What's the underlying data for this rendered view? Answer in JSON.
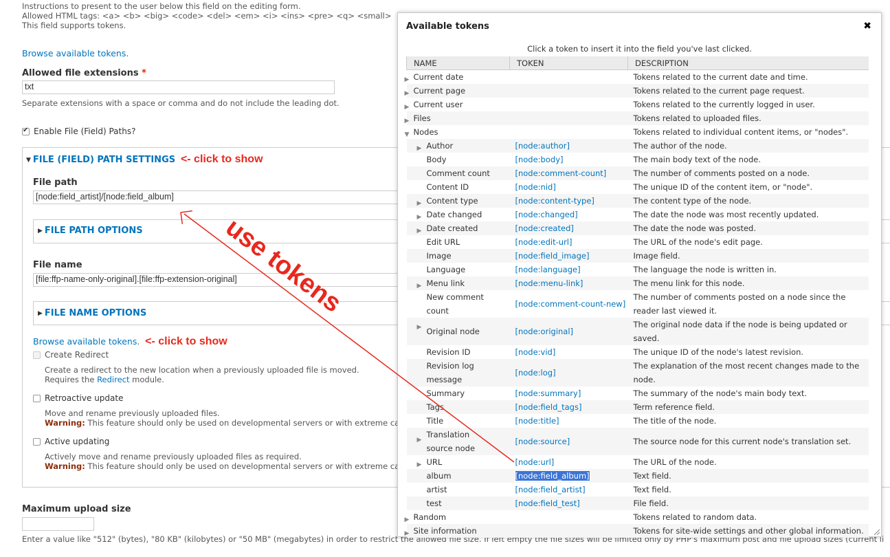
{
  "top": {
    "line1": "Instructions to present to the user below this field on the editing form.",
    "line2": "Allowed HTML tags: <a> <b> <big> <code> <del> <em> <i> <ins> <pre> <q> <small>",
    "line3": "This field supports tokens."
  },
  "browse_tokens_link": "Browse available tokens.",
  "allowed_ext": {
    "label": "Allowed file extensions",
    "required": "*",
    "value": "txt",
    "desc": "Separate extensions with a space or comma and do not include the leading dot."
  },
  "enable_ffp": {
    "label": "Enable File (Field) Paths?",
    "checked": true
  },
  "ffp_settings": {
    "legend": "FILE (FIELD) PATH SETTINGS",
    "note": "<- click to show",
    "file_path_label": "File path",
    "file_path_value": "[node:field_artist]/[node:field_album]",
    "file_path_options": "FILE PATH OPTIONS",
    "file_name_label": "File name",
    "file_name_value": "[file:ffp-name-only-original].[file:ffp-extension-original]",
    "file_name_options": "FILE NAME OPTIONS",
    "browse_link": "Browse available tokens.",
    "browse_note": "<- click to show",
    "create_redirect": {
      "label": "Create Redirect",
      "desc1": "Create a redirect to the new location when a previously uploaded file is moved.",
      "desc2_pre": "Requires the ",
      "desc2_link": "Redirect",
      "desc2_post": " module."
    },
    "retroactive": {
      "label": "Retroactive update",
      "desc1": "Move and rename previously uploaded files.",
      "warn": "Warning:",
      "desc2": " This feature should only be used on developmental servers or with extreme ca"
    },
    "active": {
      "label": "Active updating",
      "desc1": "Actively move and rename previously uploaded files as required.",
      "warn": "Warning:",
      "desc2": " This feature should only be used on developmental servers or with extreme ca"
    }
  },
  "max_upload": {
    "label": "Maximum upload size",
    "value": "",
    "desc": "Enter a value like \"512\" (bytes), \"80 KB\" (kilobytes) or \"50 MB\" (megabytes) in order to restrict the allowed file size. If left empty the file sizes will be limited only by PHP's maximum post and file upload sizes (current li"
  },
  "annotation": {
    "text": "use tokens",
    "color": "#e8281e"
  },
  "dialog": {
    "title": "Available tokens",
    "close": "✖",
    "instructions": "Click a token to insert it into the field you've last clicked.",
    "headers": [
      "NAME",
      "TOKEN",
      "DESCRIPTION"
    ],
    "rows": [
      {
        "name": "Current date",
        "token": "",
        "desc": "Tokens related to the current date and time.",
        "level": 0,
        "expander": "right"
      },
      {
        "name": "Current page",
        "token": "",
        "desc": "Tokens related to the current page request.",
        "level": 0,
        "expander": "right"
      },
      {
        "name": "Current user",
        "token": "",
        "desc": "Tokens related to the currently logged in user.",
        "level": 0,
        "expander": "right"
      },
      {
        "name": "Files",
        "token": "",
        "desc": "Tokens related to uploaded files.",
        "level": 0,
        "expander": "right"
      },
      {
        "name": "Nodes",
        "token": "",
        "desc": "Tokens related to individual content items, or \"nodes\".",
        "level": 0,
        "expander": "down"
      },
      {
        "name": "Author",
        "token": "[node:author]",
        "desc": "The author of the node.",
        "level": 1,
        "expander": "right"
      },
      {
        "name": "Body",
        "token": "[node:body]",
        "desc": "The main body text of the node.",
        "level": 1,
        "expander": ""
      },
      {
        "name": "Comment count",
        "token": "[node:comment-count]",
        "desc": "The number of comments posted on a node.",
        "level": 1,
        "expander": ""
      },
      {
        "name": "Content ID",
        "token": "[node:nid]",
        "desc": "The unique ID of the content item, or \"node\".",
        "level": 1,
        "expander": ""
      },
      {
        "name": "Content type",
        "token": "[node:content-type]",
        "desc": "The content type of the node.",
        "level": 1,
        "expander": "right"
      },
      {
        "name": "Date changed",
        "token": "[node:changed]",
        "desc": "The date the node was most recently updated.",
        "level": 1,
        "expander": "right"
      },
      {
        "name": "Date created",
        "token": "[node:created]",
        "desc": "The date the node was posted.",
        "level": 1,
        "expander": "right"
      },
      {
        "name": "Edit URL",
        "token": "[node:edit-url]",
        "desc": "The URL of the node's edit page.",
        "level": 1,
        "expander": ""
      },
      {
        "name": "Image",
        "token": "[node:field_image]",
        "desc": "Image field.",
        "level": 1,
        "expander": ""
      },
      {
        "name": "Language",
        "token": "[node:language]",
        "desc": "The language the node is written in.",
        "level": 1,
        "expander": ""
      },
      {
        "name": "Menu link",
        "token": "[node:menu-link]",
        "desc": "The menu link for this node.",
        "level": 1,
        "expander": "right"
      },
      {
        "name": "New comment count",
        "token": "[node:comment-count-new]",
        "desc": "The number of comments posted on a node since the reader last viewed it.",
        "level": 1,
        "expander": "",
        "tall": true
      },
      {
        "name": "Original node",
        "token": "[node:original]",
        "desc": "The original node data if the node is being updated or saved.",
        "level": 1,
        "expander": "right"
      },
      {
        "name": "Revision ID",
        "token": "[node:vid]",
        "desc": "The unique ID of the node's latest revision.",
        "level": 1,
        "expander": ""
      },
      {
        "name": "Revision log message",
        "token": "[node:log]",
        "desc": "The explanation of the most recent changes made to the node.",
        "level": 1,
        "expander": "",
        "tall": true
      },
      {
        "name": "Summary",
        "token": "[node:summary]",
        "desc": "The summary of the node's main body text.",
        "level": 1,
        "expander": ""
      },
      {
        "name": "Tags",
        "token": "[node:field_tags]",
        "desc": "Term reference field.",
        "level": 1,
        "expander": ""
      },
      {
        "name": "Title",
        "token": "[node:title]",
        "desc": "The title of the node.",
        "level": 1,
        "expander": ""
      },
      {
        "name": "Translation source node",
        "token": "[node:source]",
        "desc": "The source node for this current node's translation set.",
        "level": 1,
        "expander": "right",
        "tall": true
      },
      {
        "name": "URL",
        "token": "[node:url]",
        "desc": "The URL of the node.",
        "level": 1,
        "expander": "right"
      },
      {
        "name": "album",
        "token": "[node:field_album]",
        "desc": "Text field.",
        "level": 1,
        "expander": "",
        "selected": true
      },
      {
        "name": "artist",
        "token": "[node:field_artist]",
        "desc": "Text field.",
        "level": 1,
        "expander": ""
      },
      {
        "name": "test",
        "token": "[node:field_test]",
        "desc": "File field.",
        "level": 1,
        "expander": ""
      },
      {
        "name": "Random",
        "token": "",
        "desc": "Tokens related to random data.",
        "level": 0,
        "expander": "right"
      },
      {
        "name": "Site information",
        "token": "",
        "desc": "Tokens for site-wide settings and other global information.",
        "level": 0,
        "expander": "right"
      }
    ]
  }
}
